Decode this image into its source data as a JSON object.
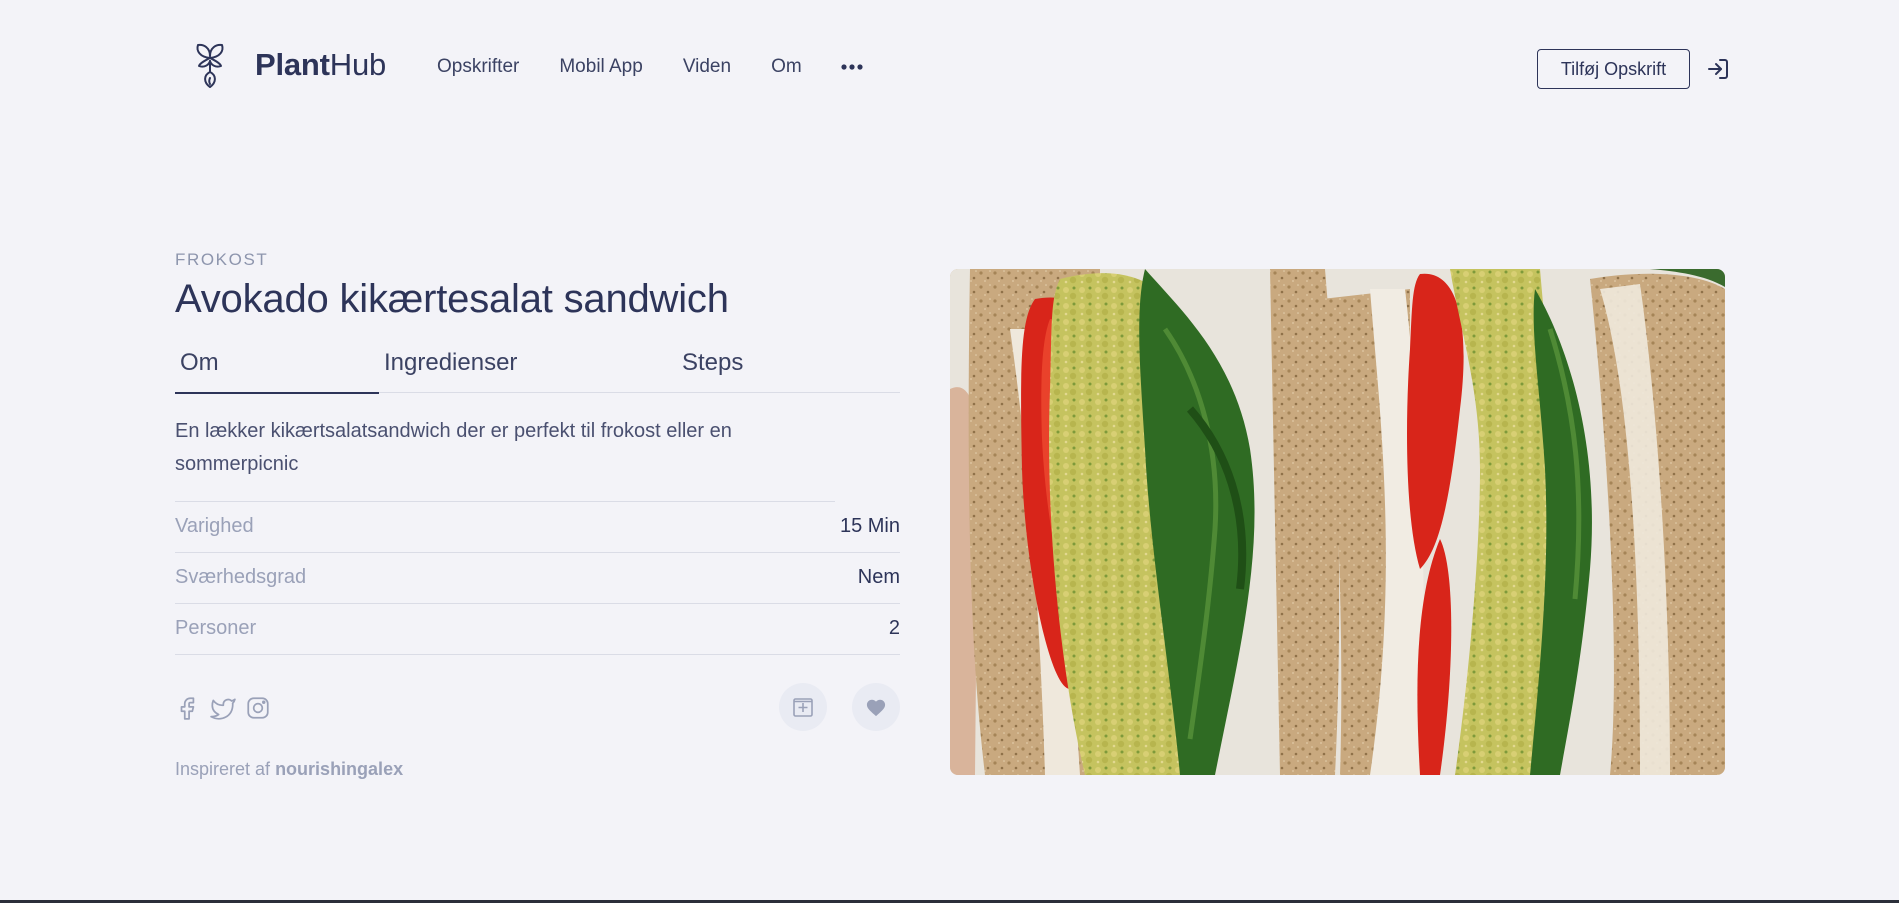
{
  "brand": {
    "name_bold": "Plant",
    "name_regular": "Hub"
  },
  "nav": {
    "items": [
      {
        "label": "Opskrifter"
      },
      {
        "label": "Mobil App"
      },
      {
        "label": "Viden"
      },
      {
        "label": "Om"
      }
    ],
    "more_icon": "more-dots-icon"
  },
  "header_actions": {
    "add_recipe_label": "Tilføj Opskrift",
    "login_icon": "login-icon"
  },
  "recipe": {
    "category": "FROKOST",
    "title": "Avokado kikærtesalat sandwich",
    "tabs": [
      {
        "label": "Om",
        "active": true
      },
      {
        "label": "Ingredienser",
        "active": false
      },
      {
        "label": "Steps",
        "active": false
      }
    ],
    "description": "En lækker kikærtsalatsandwich der er perfekt til frokost eller en sommerpicnic",
    "info": [
      {
        "label": "Varighed",
        "value": "15 Min"
      },
      {
        "label": "Sværhedsgrad",
        "value": "Nem"
      },
      {
        "label": "Personer",
        "value": "2"
      }
    ],
    "social_icons": [
      "facebook-icon",
      "twitter-icon",
      "instagram-icon"
    ],
    "action_icons": [
      "add-to-list-icon",
      "heart-icon"
    ],
    "inspired_prefix": "Inspireret af",
    "inspired_author": "nourishingalex",
    "image_alt": "Avocado chickpea salad sandwich with tomato and spinach"
  },
  "colors": {
    "background": "#f3f3f8",
    "primary": "#2d3459",
    "muted": "#9aa1b8",
    "divider": "#dadce6",
    "button_circle": "#e9ebf3"
  }
}
